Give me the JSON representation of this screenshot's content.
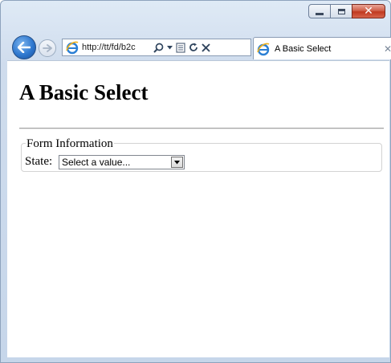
{
  "browser": {
    "address_url": "http://tt/fd/b2c",
    "tab_title": "A Basic Select",
    "icons": [
      "back-arrow-icon",
      "forward-arrow-icon",
      "ie-logo-icon",
      "search-icon",
      "dropdown-icon",
      "compatibility-view-icon",
      "refresh-icon",
      "stop-icon",
      "close-tab-icon"
    ]
  },
  "page": {
    "title": "A Basic Select",
    "fieldset_legend": "Form Information",
    "state_label": "State:",
    "select_value": "Select a value..."
  }
}
